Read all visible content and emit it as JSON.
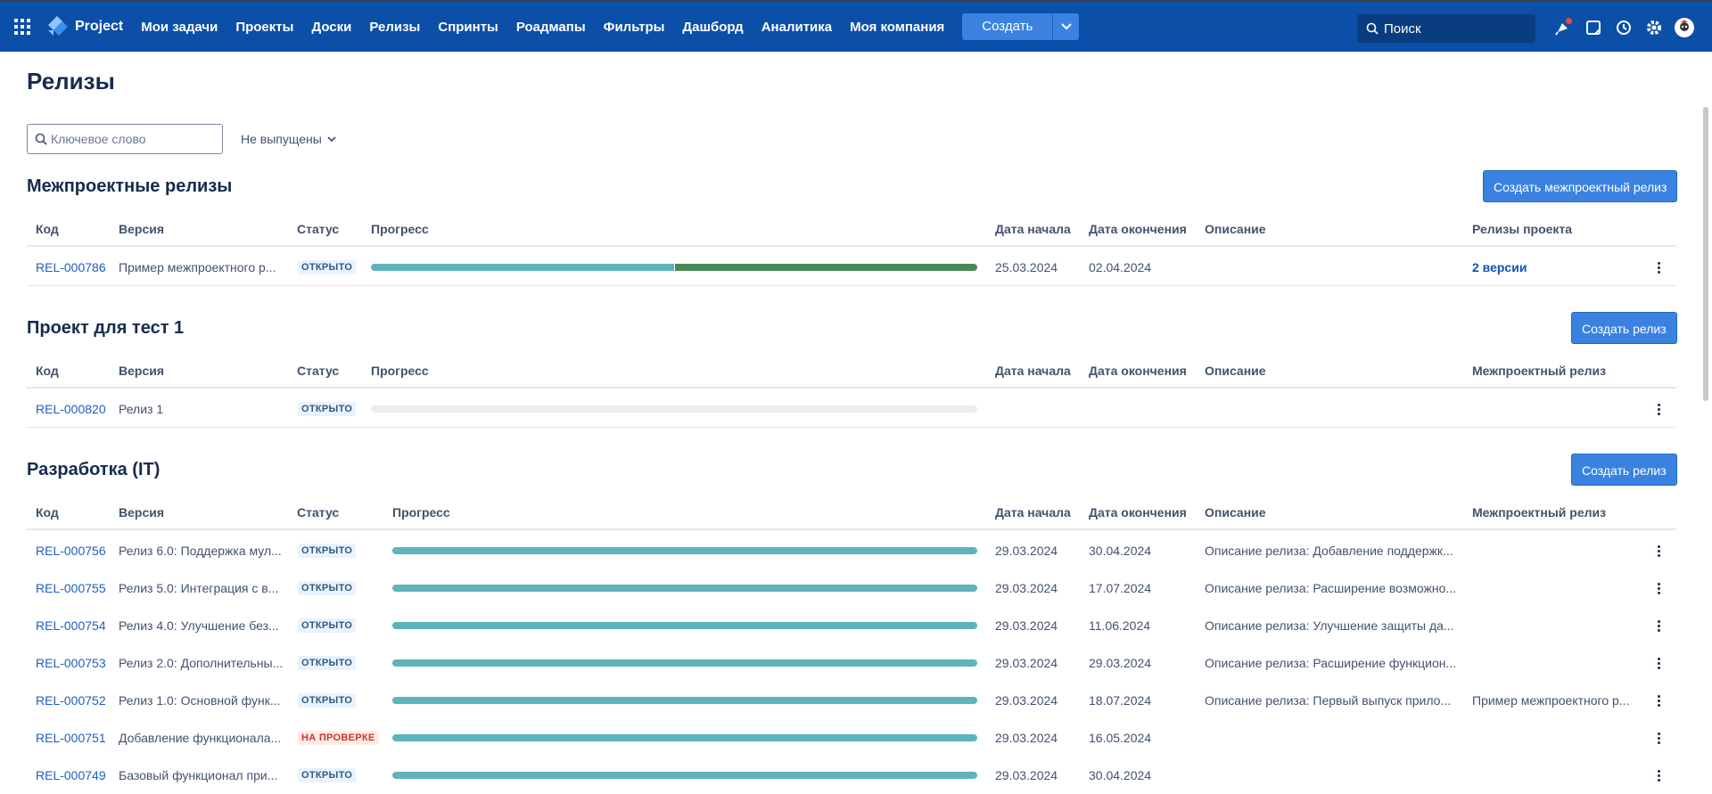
{
  "header": {
    "app_name": "Project",
    "nav": [
      "Мои задачи",
      "Проекты",
      "Доски",
      "Релизы",
      "Спринты",
      "Роадмапы",
      "Фильтры",
      "Дашборд",
      "Аналитика",
      "Моя компания"
    ],
    "create_label": "Создать",
    "search_placeholder": "Поиск"
  },
  "page": {
    "title": "Релизы",
    "keyword_placeholder": "Ключевое слово",
    "status_filter": "Не выпущены"
  },
  "colors": {
    "progress_in_progress": "#5fb3ba",
    "progress_done": "#4a8a57",
    "progress_empty": "#ededed"
  },
  "cross": {
    "title": "Межпроектные релизы",
    "button": "Создать межпроектный релиз",
    "columns": {
      "code": "Код",
      "version": "Версия",
      "status": "Статус",
      "progress": "Прогресс",
      "start": "Дата начала",
      "end": "Дата окончения",
      "description": "Описание",
      "related": "Релизы проекта"
    },
    "rows": [
      {
        "code": "REL-000786",
        "version": "Пример межпроектного р...",
        "status": "ОТКРЫТО",
        "progress": {
          "in_progress": 0.5,
          "done": 0.5
        },
        "start": "25.03.2024",
        "end": "02.04.2024",
        "description": "",
        "related": "2 версии"
      }
    ]
  },
  "test": {
    "title": "Проект для тест 1",
    "button": "Создать релиз",
    "columns": {
      "code": "Код",
      "version": "Версия",
      "status": "Статус",
      "progress": "Прогресс",
      "start": "Дата начала",
      "end": "Дата окончения",
      "description": "Описание",
      "related": "Межпроектный релиз"
    },
    "rows": [
      {
        "code": "REL-000820",
        "version": "Релиз 1",
        "status": "ОТКРЫТО",
        "progress": {
          "in_progress": 0,
          "done": 0
        },
        "start": "",
        "end": "",
        "description": "",
        "related": ""
      }
    ]
  },
  "dev": {
    "title": "Разработка (IT)",
    "button": "Создать релиз",
    "columns": {
      "code": "Код",
      "version": "Версия",
      "status": "Статус",
      "progress": "Прогресс",
      "start": "Дата начала",
      "end": "Дата окончения",
      "description": "Описание",
      "related": "Межпроектный релиз"
    },
    "rows": [
      {
        "code": "REL-000756",
        "version": "Релиз 6.0: Поддержка мул...",
        "status": "ОТКРЫТО",
        "progress": {
          "in_progress": 1,
          "done": 0
        },
        "start": "29.03.2024",
        "end": "30.04.2024",
        "description": "Описание релиза: Добавление поддержк...",
        "related": ""
      },
      {
        "code": "REL-000755",
        "version": "Релиз 5.0: Интеграция с в...",
        "status": "ОТКРЫТО",
        "progress": {
          "in_progress": 1,
          "done": 0
        },
        "start": "29.03.2024",
        "end": "17.07.2024",
        "description": "Описание релиза: Расширение возможно...",
        "related": ""
      },
      {
        "code": "REL-000754",
        "version": "Релиз 4.0: Улучшение без...",
        "status": "ОТКРЫТО",
        "progress": {
          "in_progress": 1,
          "done": 0
        },
        "start": "29.03.2024",
        "end": "11.06.2024",
        "description": "Описание релиза: Улучшение защиты да...",
        "related": ""
      },
      {
        "code": "REL-000753",
        "version": "Релиз 2.0: Дополнительны...",
        "status": "ОТКРЫТО",
        "progress": {
          "in_progress": 1,
          "done": 0
        },
        "start": "29.03.2024",
        "end": "29.03.2024",
        "description": "Описание релиза: Расширение функцион...",
        "related": ""
      },
      {
        "code": "REL-000752",
        "version": "Релиз 1.0: Основной функ...",
        "status": "ОТКРЫТО",
        "progress": {
          "in_progress": 1,
          "done": 0
        },
        "start": "29.03.2024",
        "end": "18.07.2024",
        "description": "Описание релиза: Первый выпуск прило...",
        "related": "Пример межпроектного р..."
      },
      {
        "code": "REL-000751",
        "version": "Добавление функционала...",
        "status": "НА ПРОВЕРКЕ",
        "progress": {
          "in_progress": 1,
          "done": 0
        },
        "start": "29.03.2024",
        "end": "16.05.2024",
        "description": "",
        "related": ""
      },
      {
        "code": "REL-000749",
        "version": "Базовый функционал при...",
        "status": "ОТКРЫТО",
        "progress": {
          "in_progress": 1,
          "done": 0
        },
        "start": "29.03.2024",
        "end": "30.04.2024",
        "description": "",
        "related": ""
      }
    ]
  }
}
